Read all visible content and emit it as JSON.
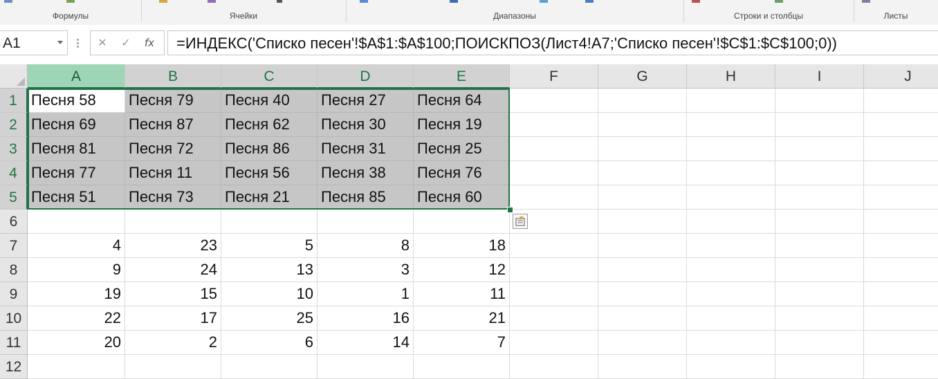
{
  "ribbon": {
    "groups": [
      {
        "label": "Формулы"
      },
      {
        "label": "Ячейки"
      },
      {
        "label": "Диапазоны"
      },
      {
        "label": "Строки и столбцы"
      },
      {
        "label": "Листы"
      }
    ]
  },
  "formula_bar": {
    "name_box": "A1",
    "cancel_icon": "✕",
    "enter_icon": "✓",
    "fx_label": "fx",
    "formula": "=ИНДЕКС('Списко песен'!$A$1:$A$100;ПОИСКПОЗ(Лист4!A7;'Списко песен'!$C$1:$C$100;0))"
  },
  "sheet": {
    "columns": [
      "A",
      "B",
      "C",
      "D",
      "E",
      "F",
      "G",
      "H",
      "I",
      "J"
    ],
    "rows": [
      "1",
      "2",
      "3",
      "4",
      "5",
      "6",
      "7",
      "8",
      "9",
      "10",
      "11",
      "12"
    ],
    "cells": [
      [
        "Песня 58",
        "Песня 79",
        "Песня 40",
        "Песня 27",
        "Песня 64"
      ],
      [
        "Песня 69",
        "Песня 87",
        "Песня 62",
        "Песня 30",
        "Песня 19"
      ],
      [
        "Песня 81",
        "Песня 72",
        "Песня 86",
        "Песня 31",
        "Песня 25"
      ],
      [
        "Песня 77",
        "Песня 11",
        "Песня 56",
        "Песня 38",
        "Песня 76"
      ],
      [
        "Песня 51",
        "Песня 73",
        "Песня 21",
        "Песня 85",
        "Песня 60"
      ],
      [
        "",
        "",
        "",
        "",
        ""
      ],
      [
        "4",
        "23",
        "5",
        "8",
        "18"
      ],
      [
        "9",
        "24",
        "13",
        "3",
        "12"
      ],
      [
        "19",
        "15",
        "10",
        "1",
        "11"
      ],
      [
        "22",
        "17",
        "25",
        "16",
        "21"
      ],
      [
        "20",
        "2",
        "6",
        "14",
        "7"
      ],
      [
        "",
        "",
        "",
        "",
        ""
      ]
    ]
  },
  "colors": {
    "accent": "#217346",
    "selection_fill": "#c6c6c6",
    "active_header": "#9fd5b7"
  },
  "icons": {
    "quick_analysis": "quick-analysis-icon"
  }
}
